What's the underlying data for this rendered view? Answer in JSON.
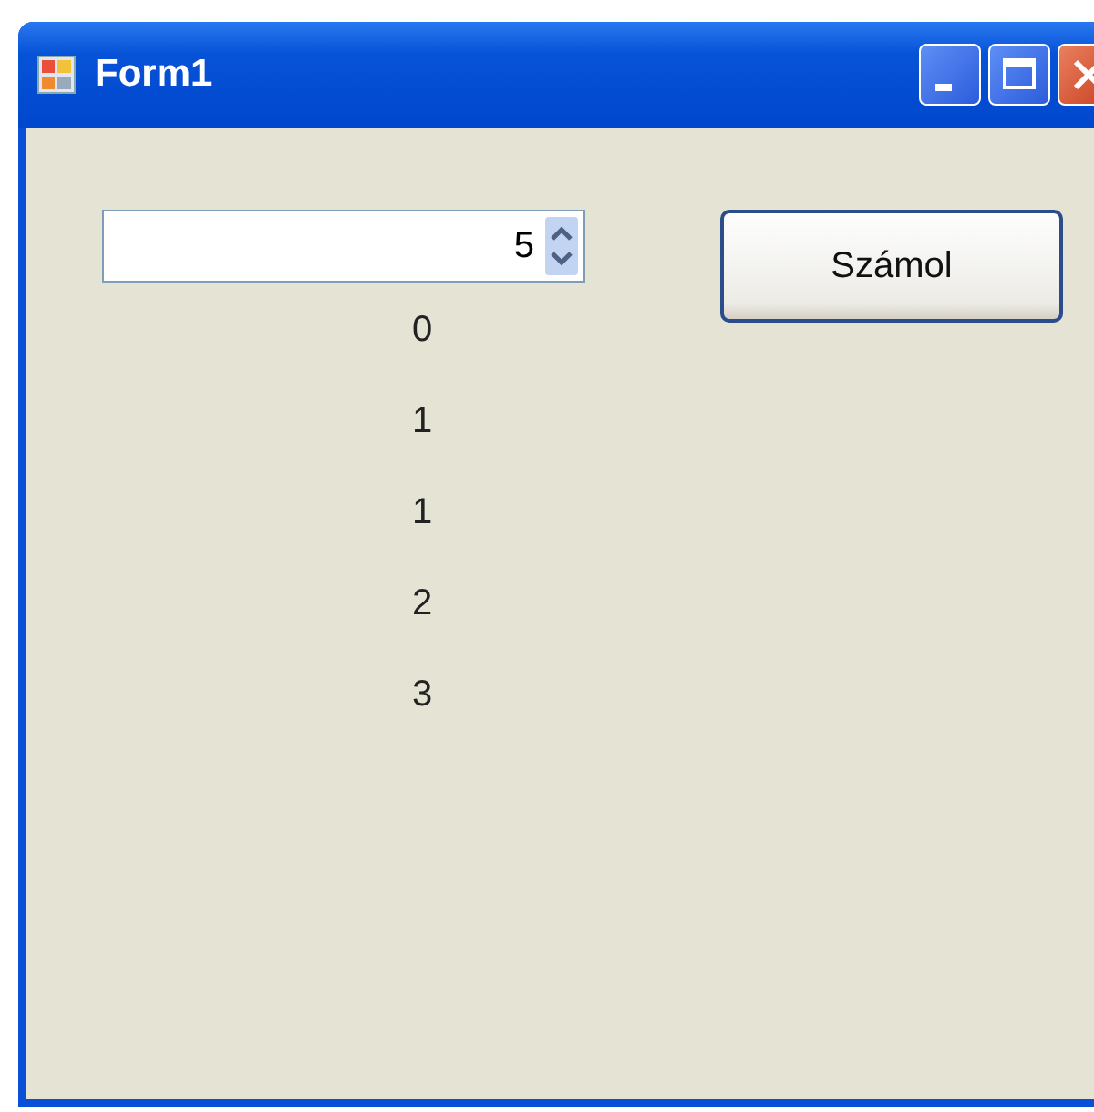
{
  "window": {
    "title": "Form1"
  },
  "spinbox": {
    "value": "5"
  },
  "button": {
    "label": "Számol"
  },
  "results": [
    "0",
    "1",
    "1",
    "2",
    "3"
  ]
}
